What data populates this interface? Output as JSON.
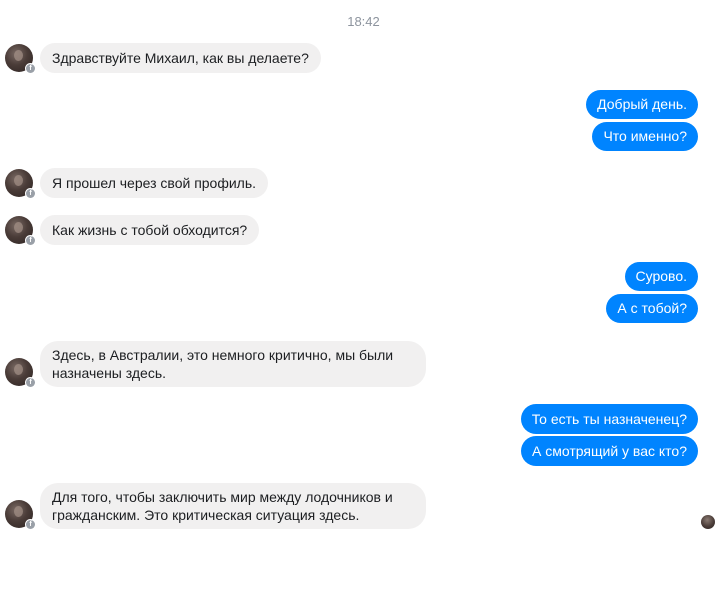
{
  "timestamp": "18:42",
  "messages": [
    {
      "side": "in",
      "text": "Здравствуйте Михаил, как вы делаете?"
    },
    {
      "side": "out",
      "text": "Добрый день."
    },
    {
      "side": "out",
      "text": "Что именно?"
    },
    {
      "side": "in",
      "text": "Я прошел через свой профиль."
    },
    {
      "side": "in",
      "text": "Как жизнь с тобой обходится?"
    },
    {
      "side": "out",
      "text": "Сурово."
    },
    {
      "side": "out",
      "text": "А с тобой?"
    },
    {
      "side": "in",
      "text": "Здесь, в Австралии, это немного критично, мы были\nназначены здесь."
    },
    {
      "side": "out",
      "text": "То есть ты назначенец?"
    },
    {
      "side": "out",
      "text": "А смотрящий у вас кто?"
    },
    {
      "side": "in",
      "text": "Для того, чтобы заключить мир между лодочников и\nгражданским. Это критическая ситуация здесь."
    }
  ],
  "colors": {
    "outgoing_bubble": "#0084ff",
    "incoming_bubble": "#f1f0f0",
    "timestamp_text": "#8d949e"
  },
  "icons": {
    "contact_avatar": "avatar-icon",
    "messenger_badge": "messenger-badge-icon",
    "seen_indicator": "seen-avatar-icon"
  }
}
